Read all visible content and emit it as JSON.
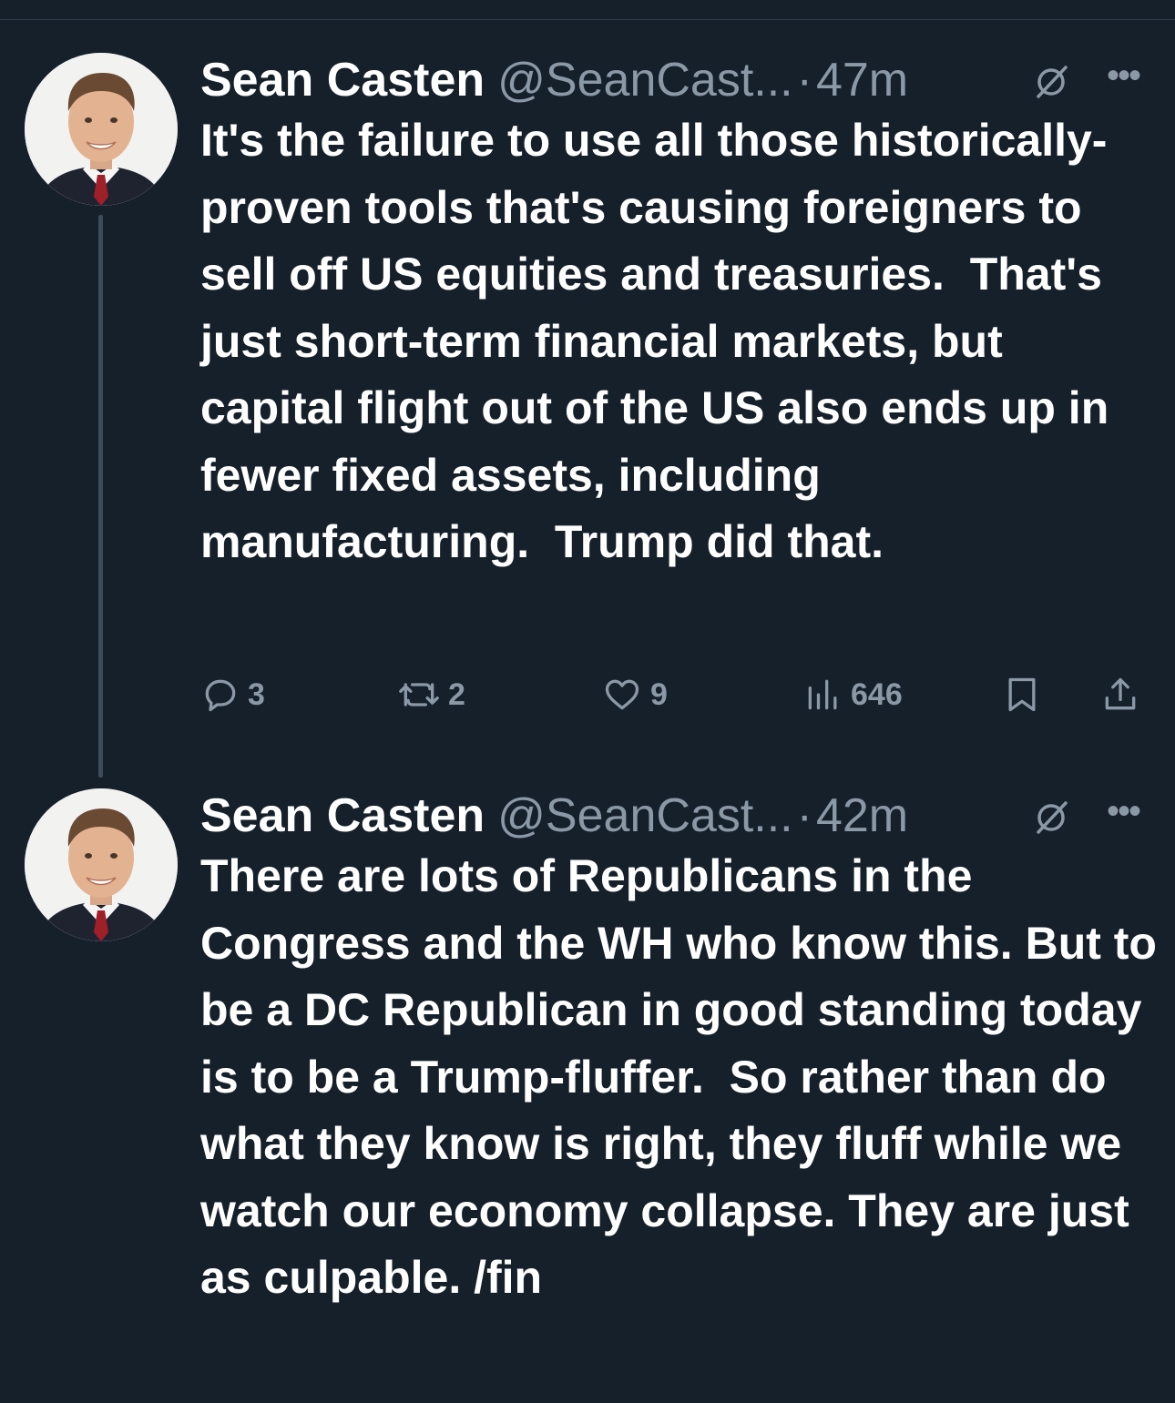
{
  "tweets": [
    {
      "name": "Sean Casten",
      "handle": "@SeanCast...",
      "separator": "·",
      "time": "47m",
      "text": "It's the failure to use all those historically-proven tools that's causing foreigners to sell off US equities and treasuries.  That's just short-term financial markets, but capital flight out of the US also ends up in fewer fixed assets, including manufacturing.  Trump did that.",
      "replies": "3",
      "retweets": "2",
      "likes": "9",
      "views": "646"
    },
    {
      "name": "Sean Casten",
      "handle": "@SeanCast...",
      "separator": "·",
      "time": "42m",
      "text": "There are lots of Republicans in the Congress and the WH who know this. But to be a DC Republican in good standing today is to be a Trump-fluffer.  So rather than do what they know is right, they fluff while we watch our economy collapse. They are just as culpable. /fin"
    }
  ],
  "icons": {
    "reply": "reply-icon",
    "retweet": "retweet-icon",
    "like": "heart-icon",
    "views": "views-icon",
    "bookmark": "bookmark-icon",
    "share": "share-icon",
    "grok": "grok-icon",
    "more": "more-icon"
  },
  "colors": {
    "background": "#15202b",
    "text": "#ffffff",
    "secondary": "#8b98a5",
    "thread_line": "#3d4a57"
  }
}
